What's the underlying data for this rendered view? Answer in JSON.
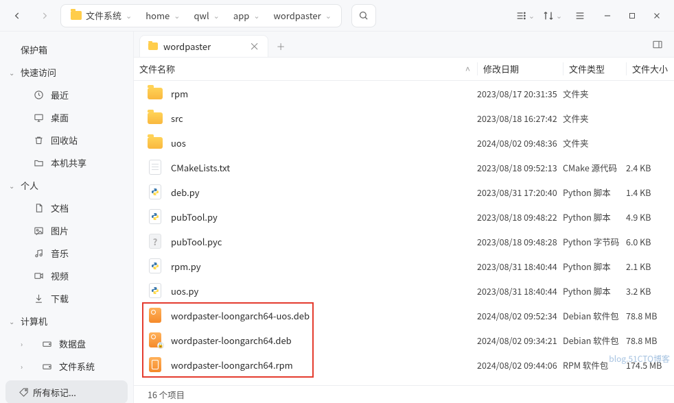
{
  "breadcrumbs": {
    "root_label": "文件系统",
    "items": [
      "home",
      "qwl",
      "app",
      "wordpaster"
    ]
  },
  "sidebar": {
    "items": [
      {
        "label": "保护箱",
        "kind": "header",
        "icon": null,
        "expandable": false
      },
      {
        "label": "快速访问",
        "kind": "header",
        "icon": null,
        "expandable": true
      },
      {
        "label": "最近",
        "kind": "child",
        "icon": "clock"
      },
      {
        "label": "桌面",
        "kind": "child",
        "icon": "desktop"
      },
      {
        "label": "回收站",
        "kind": "child",
        "icon": "trash"
      },
      {
        "label": "本机共享",
        "kind": "child",
        "icon": "folder"
      },
      {
        "label": "个人",
        "kind": "header",
        "icon": null,
        "expandable": true
      },
      {
        "label": "文档",
        "kind": "child",
        "icon": "doc"
      },
      {
        "label": "图片",
        "kind": "child",
        "icon": "image"
      },
      {
        "label": "音乐",
        "kind": "child",
        "icon": "music"
      },
      {
        "label": "视频",
        "kind": "child",
        "icon": "video"
      },
      {
        "label": "下载",
        "kind": "child",
        "icon": "download"
      },
      {
        "label": "计算机",
        "kind": "header",
        "icon": null,
        "expandable": true
      },
      {
        "label": "数据盘",
        "kind": "child2",
        "icon": "disk",
        "expandable": true
      },
      {
        "label": "文件系统",
        "kind": "child2",
        "icon": "disk",
        "expandable": true
      }
    ],
    "active": {
      "label": "所有标记...",
      "icon": "tag"
    }
  },
  "tab": {
    "label": "wordpaster"
  },
  "columns": {
    "name": "文件名称",
    "date": "修改日期",
    "type": "文件类型",
    "size": "文件大小"
  },
  "files": [
    {
      "name": "rpm",
      "date": "2023/08/17 20:31:35",
      "type": "文件夹",
      "size": "",
      "icon": "folder"
    },
    {
      "name": "src",
      "date": "2023/08/18 16:27:42",
      "type": "文件夹",
      "size": "",
      "icon": "folder"
    },
    {
      "name": "uos",
      "date": "2024/08/02 09:48:36",
      "type": "文件夹",
      "size": "",
      "icon": "folder"
    },
    {
      "name": "CMakeLists.txt",
      "date": "2023/08/18 09:52:13",
      "type": "CMake 源代码",
      "size": "2.4 KB",
      "icon": "file"
    },
    {
      "name": "deb.py",
      "date": "2023/08/31 17:20:40",
      "type": "Python 脚本",
      "size": "1.4 KB",
      "icon": "py"
    },
    {
      "name": "pubTool.py",
      "date": "2023/08/18 09:48:22",
      "type": "Python 脚本",
      "size": "4.9 KB",
      "icon": "py"
    },
    {
      "name": "pubTool.pyc",
      "date": "2023/08/18 09:48:28",
      "type": "Python 字节码",
      "size": "6.0 KB",
      "icon": "pyc"
    },
    {
      "name": "rpm.py",
      "date": "2023/08/31 18:40:44",
      "type": "Python 脚本",
      "size": "2.1 KB",
      "icon": "py"
    },
    {
      "name": "uos.py",
      "date": "2023/08/31 18:40:44",
      "type": "Python 脚本",
      "size": "3.2 KB",
      "icon": "py"
    },
    {
      "name": "wordpaster-loongarch64-uos.deb",
      "date": "2024/08/02 09:52:34",
      "type": "Debian 软件包",
      "size": "78.8 MB",
      "icon": "deb"
    },
    {
      "name": "wordpaster-loongarch64.deb",
      "date": "2024/08/02 09:34:21",
      "type": "Debian 软件包",
      "size": "78.8 MB",
      "icon": "deb",
      "locked": true
    },
    {
      "name": "wordpaster-loongarch64.rpm",
      "date": "2024/08/02 09:44:06",
      "type": "RPM 软件包",
      "size": "174.5 MB",
      "icon": "rpm"
    }
  ],
  "status": {
    "text": "16 个项目"
  },
  "watermark": "blog.51CTO博客"
}
